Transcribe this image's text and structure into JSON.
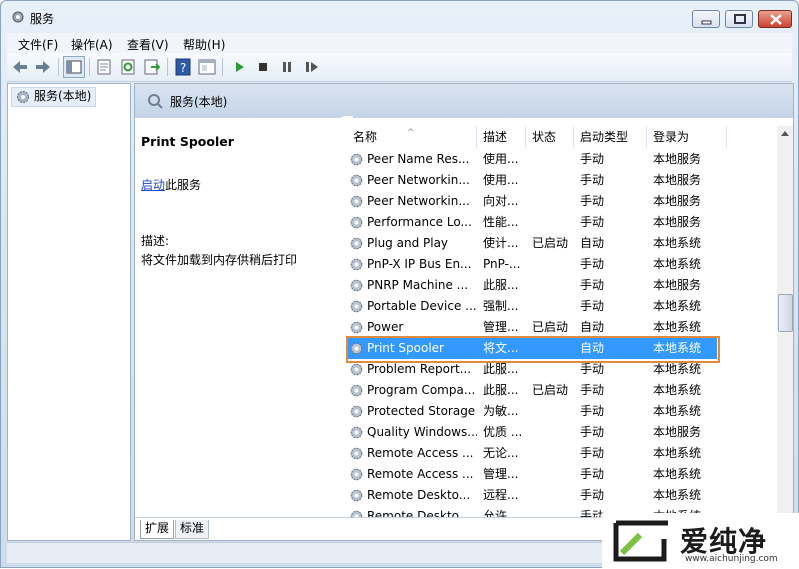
{
  "window": {
    "title": "服务"
  },
  "menu": [
    "文件(F)",
    "操作(A)",
    "查看(V)",
    "帮助(H)"
  ],
  "toolbar_icons": [
    "back-icon",
    "forward-icon",
    "show-console-tree-icon",
    "properties-icon",
    "refresh-icon",
    "export-list-icon",
    "help-icon",
    "view-icon",
    "start-service-icon",
    "stop-service-icon",
    "pause-service-icon",
    "restart-service-icon"
  ],
  "tree": {
    "item": "服务(本地)"
  },
  "pane": {
    "title": "服务(本地)",
    "selected_name": "Print Spooler",
    "start_link": "启动",
    "start_suffix": "此服务",
    "desc_label": "描述:",
    "desc_text": "将文件加载到内存供稍后打印"
  },
  "columns": {
    "name": "名称",
    "desc": "描述",
    "status": "状态",
    "startup": "启动类型",
    "logon": "登录为"
  },
  "rows": [
    {
      "name": "Peer Name Res...",
      "desc": "使用...",
      "status": "",
      "startup": "手动",
      "logon": "本地服务"
    },
    {
      "name": "Peer Networkin...",
      "desc": "使用...",
      "status": "",
      "startup": "手动",
      "logon": "本地服务"
    },
    {
      "name": "Peer Networkin...",
      "desc": "向对...",
      "status": "",
      "startup": "手动",
      "logon": "本地服务"
    },
    {
      "name": "Performance Lo...",
      "desc": "性能...",
      "status": "",
      "startup": "手动",
      "logon": "本地服务"
    },
    {
      "name": "Plug and Play",
      "desc": "使计...",
      "status": "已启动",
      "startup": "自动",
      "logon": "本地系统"
    },
    {
      "name": "PnP-X IP Bus En...",
      "desc": "PnP-...",
      "status": "",
      "startup": "手动",
      "logon": "本地系统"
    },
    {
      "name": "PNRP Machine ...",
      "desc": "此服...",
      "status": "",
      "startup": "手动",
      "logon": "本地服务"
    },
    {
      "name": "Portable Device ...",
      "desc": "强制...",
      "status": "",
      "startup": "手动",
      "logon": "本地系统"
    },
    {
      "name": "Power",
      "desc": "管理...",
      "status": "已启动",
      "startup": "自动",
      "logon": "本地系统"
    },
    {
      "name": "Print Spooler",
      "desc": "将文...",
      "status": "",
      "startup": "自动",
      "logon": "本地系统"
    },
    {
      "name": "Problem Report...",
      "desc": "此服...",
      "status": "",
      "startup": "手动",
      "logon": "本地系统"
    },
    {
      "name": "Program Compa...",
      "desc": "此服...",
      "status": "已启动",
      "startup": "手动",
      "logon": "本地系统"
    },
    {
      "name": "Protected Storage",
      "desc": "为敏...",
      "status": "",
      "startup": "手动",
      "logon": "本地系统"
    },
    {
      "name": "Quality Windows...",
      "desc": "优质 ...",
      "status": "",
      "startup": "手动",
      "logon": "本地服务"
    },
    {
      "name": "Remote Access ...",
      "desc": "无论...",
      "status": "",
      "startup": "手动",
      "logon": "本地系统"
    },
    {
      "name": "Remote Access ...",
      "desc": "管理...",
      "status": "",
      "startup": "手动",
      "logon": "本地系统"
    },
    {
      "name": "Remote Deskto...",
      "desc": "远程...",
      "status": "",
      "startup": "手动",
      "logon": "本地系统"
    },
    {
      "name": "Remote Deskto...",
      "desc": "允许...",
      "status": "",
      "startup": "手动",
      "logon": "本地系统"
    }
  ],
  "selected_row_index": 9,
  "tabs": [
    "扩展",
    "标准"
  ],
  "watermark": {
    "text": "爱纯净",
    "url": "www.aichunjing.com"
  },
  "colors": {
    "selection": "#3399ff",
    "highlight_frame": "#e08a3c",
    "link": "#1a49c8"
  }
}
